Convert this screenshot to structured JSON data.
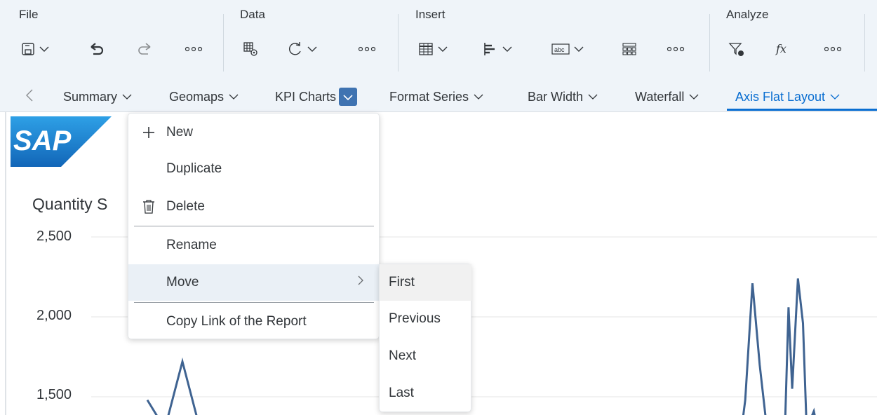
{
  "toolbar": {
    "groups": {
      "file": "File",
      "data": "Data",
      "insert": "Insert",
      "analyze": "Analyze"
    },
    "icons": [
      "save-icon",
      "undo-icon",
      "redo-icon",
      "more-icon",
      "data-settings-icon",
      "refresh-icon",
      "more-icon",
      "table-icon",
      "bar-chart-icon",
      "text-icon",
      "grid-icon",
      "more-icon",
      "filter-icon",
      "formula-icon",
      "more-icon"
    ]
  },
  "tabs": {
    "items": [
      {
        "label": "Summary"
      },
      {
        "label": "Geomaps"
      },
      {
        "label": "KPI Charts"
      },
      {
        "label": "Format Series"
      },
      {
        "label": "Bar Width"
      },
      {
        "label": "Waterfall"
      },
      {
        "label": "Axis Flat Layout"
      }
    ],
    "active": "Axis Flat Layout"
  },
  "content": {
    "logo_text": "SAP",
    "chart_title": "Quantity S"
  },
  "chart_data": {
    "type": "line",
    "title": "Quantity S",
    "yticks": [
      "2,500",
      "2,000",
      "1,500"
    ],
    "ylim": [
      1500,
      2500
    ],
    "series": [
      {
        "color": "#3f6391",
        "points": [
          [
            0.48,
            1480
          ],
          [
            0.49,
            1300
          ],
          [
            0.5,
            1720
          ],
          [
            0.51,
            1300
          ],
          [
            0.52,
            1300
          ],
          [
            0.9,
            1300
          ],
          [
            0.905,
            1480
          ],
          [
            0.915,
            2210
          ],
          [
            0.925,
            1700
          ],
          [
            0.935,
            1300
          ],
          [
            0.94,
            1300
          ],
          [
            0.96,
            1300
          ],
          [
            0.965,
            2060
          ],
          [
            0.97,
            1550
          ],
          [
            0.978,
            2240
          ],
          [
            0.985,
            1960
          ],
          [
            0.99,
            1300
          ],
          [
            1.0,
            1410
          ],
          [
            1.005,
            1300
          ]
        ]
      }
    ]
  },
  "menu": {
    "items": [
      {
        "label": "New",
        "icon": "plus-icon"
      },
      {
        "label": "Duplicate",
        "icon": ""
      },
      {
        "label": "Delete",
        "icon": "trash-icon"
      },
      {
        "label": "Rename",
        "icon": ""
      },
      {
        "label": "Move",
        "icon": "",
        "submenu": true
      },
      {
        "label": "Copy Link of the Report",
        "icon": ""
      }
    ],
    "submenu": {
      "items": [
        {
          "label": "First"
        },
        {
          "label": "Previous"
        },
        {
          "label": "Next"
        },
        {
          "label": "Last"
        }
      ]
    }
  },
  "colors": {
    "toolbar_bg": "#eff4f9",
    "accent": "#0a6ed1",
    "line": "#3f6391",
    "sap_logo": "#1f7fcf"
  }
}
